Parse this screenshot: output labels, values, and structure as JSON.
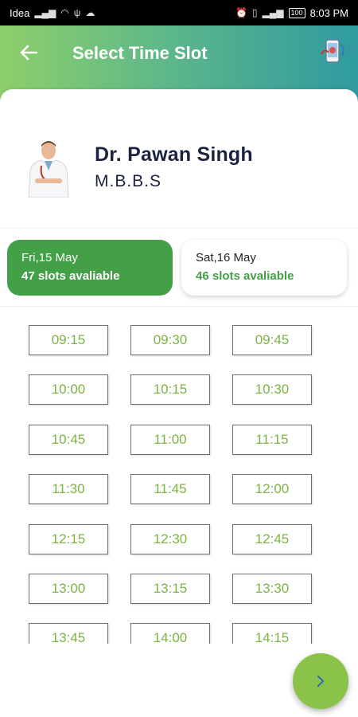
{
  "status_bar": {
    "carrier": "Idea",
    "time": "8:03 PM",
    "battery": "100"
  },
  "header": {
    "title": "Select Time Slot"
  },
  "doctor": {
    "name": "Dr. Pawan Singh",
    "degree": "M.B.B.S"
  },
  "dates": [
    {
      "date": "Fri,15 May",
      "slots": "47 slots avaliable",
      "selected": true
    },
    {
      "date": "Sat,16 May",
      "slots": "46 slots avaliable",
      "selected": false
    }
  ],
  "slots": [
    "09:15",
    "09:30",
    "09:45",
    "10:00",
    "10:15",
    "10:30",
    "10:45",
    "11:00",
    "11:15",
    "11:30",
    "11:45",
    "12:00",
    "12:15",
    "12:30",
    "12:45",
    "13:00",
    "13:15",
    "13:30",
    "13:45",
    "14:00",
    "14:15"
  ],
  "colors": {
    "accent_green": "#43a047",
    "slot_text": "#7cb342",
    "fab": "#8bc34a"
  }
}
